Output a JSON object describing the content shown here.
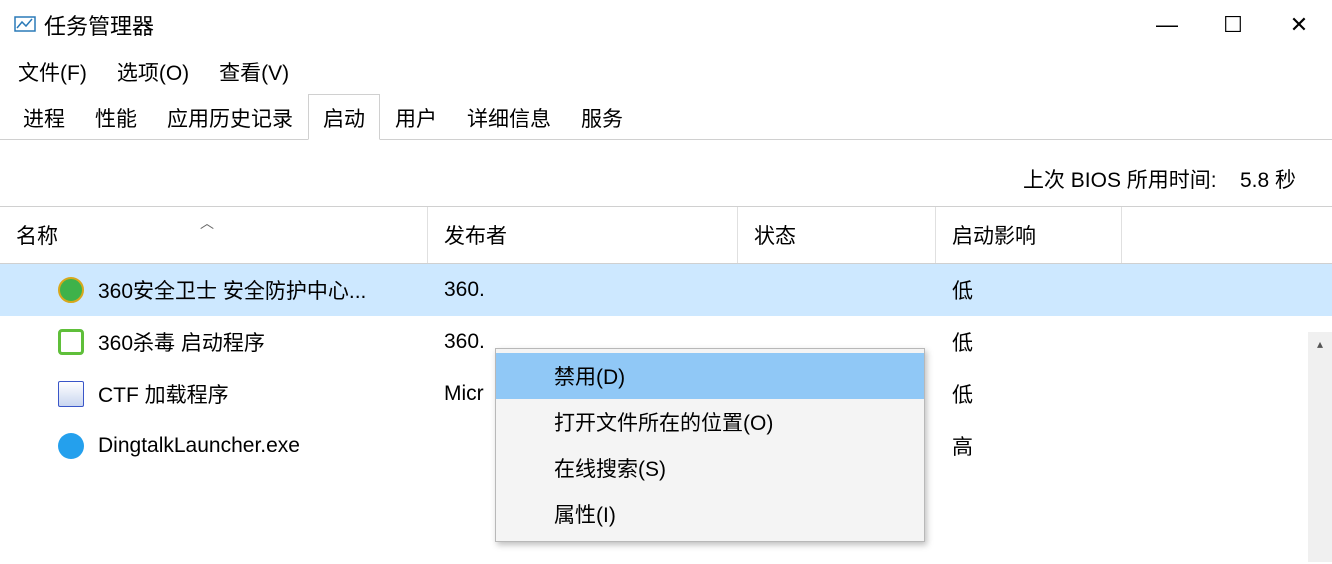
{
  "window": {
    "title": "任务管理器",
    "controls": {
      "min": "—",
      "max": "☐",
      "close": "✕"
    }
  },
  "menubar": {
    "file": "文件(F)",
    "options": "选项(O)",
    "view": "查看(V)"
  },
  "tabs": {
    "processes": "进程",
    "performance": "性能",
    "apphistory": "应用历史记录",
    "startup": "启动",
    "users": "用户",
    "details": "详细信息",
    "services": "服务"
  },
  "bios": {
    "label": "上次 BIOS 所用时间:",
    "value": "5.8 秒"
  },
  "columns": {
    "name": "名称",
    "publisher": "发布者",
    "status": "状态",
    "impact": "启动影响"
  },
  "rows": [
    {
      "name": "360安全卫士 安全防护中心...",
      "publisher": "360.",
      "status": "",
      "impact": "低",
      "icon": "#3eb24a",
      "shape": "circle"
    },
    {
      "name": "360杀毒 启动程序",
      "publisher": "360.",
      "status": "",
      "impact": "低",
      "icon": "#5fbf3a",
      "shape": "shield"
    },
    {
      "name": "CTF 加载程序",
      "publisher": "Micr",
      "status": "",
      "impact": "低",
      "icon": "#3a56c8",
      "shape": "doc"
    },
    {
      "name": "DingtalkLauncher.exe",
      "publisher": "",
      "status": "",
      "impact": "高",
      "icon": "#24a0ed",
      "shape": "circle"
    }
  ],
  "context_menu": {
    "disable": "禁用(D)",
    "open_location": "打开文件所在的位置(O)",
    "search_online": "在线搜索(S)",
    "properties": "属性(I)"
  }
}
